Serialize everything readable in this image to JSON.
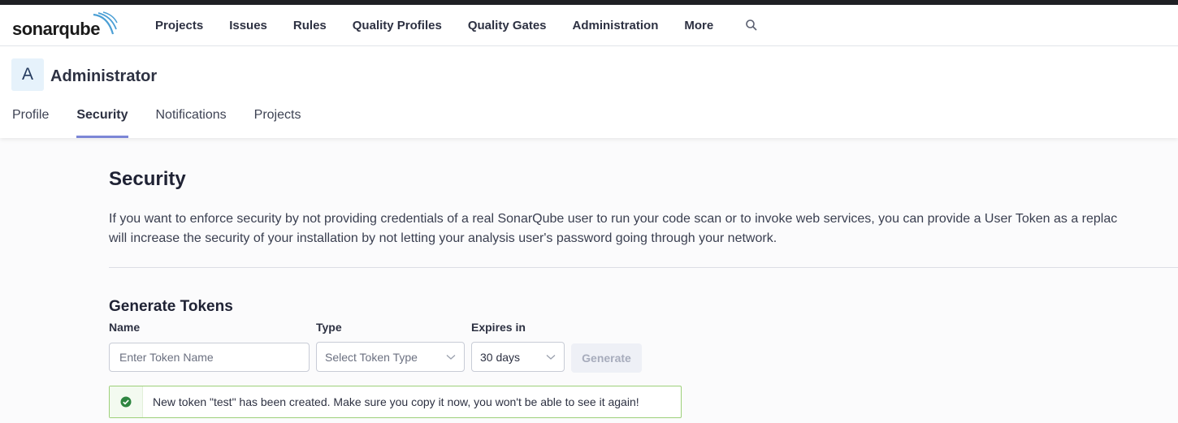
{
  "app": {
    "logo_text": "sonarqube"
  },
  "nav": {
    "items": [
      "Projects",
      "Issues",
      "Rules",
      "Quality Profiles",
      "Quality Gates",
      "Administration",
      "More"
    ],
    "search_icon": "search-icon"
  },
  "account": {
    "avatar_letter": "A",
    "name": "Administrator",
    "tabs": [
      "Profile",
      "Security",
      "Notifications",
      "Projects"
    ],
    "active_tab": "Security"
  },
  "security": {
    "title": "Security",
    "description_line1": "If you want to enforce security by not providing credentials of a real SonarQube user to run your code scan or to invoke web services, you can provide a User Token as a replac",
    "description_line2": "will increase the security of your installation by not letting your analysis user's password going through your network."
  },
  "generate": {
    "title": "Generate Tokens",
    "name_label": "Name",
    "name_placeholder": "Enter Token Name",
    "name_value": "",
    "type_label": "Type",
    "type_placeholder": "Select Token Type",
    "expires_label": "Expires in",
    "expires_value": "30 days",
    "button_label": "Generate"
  },
  "alert": {
    "text": "New token \"test\" has been created. Make sure you copy it now, you won't be able to see it again!",
    "icon": "check-circle-icon",
    "color": "#2e8540"
  },
  "colors": {
    "accent": "#7c86d6",
    "success_border": "#9dd07a"
  }
}
